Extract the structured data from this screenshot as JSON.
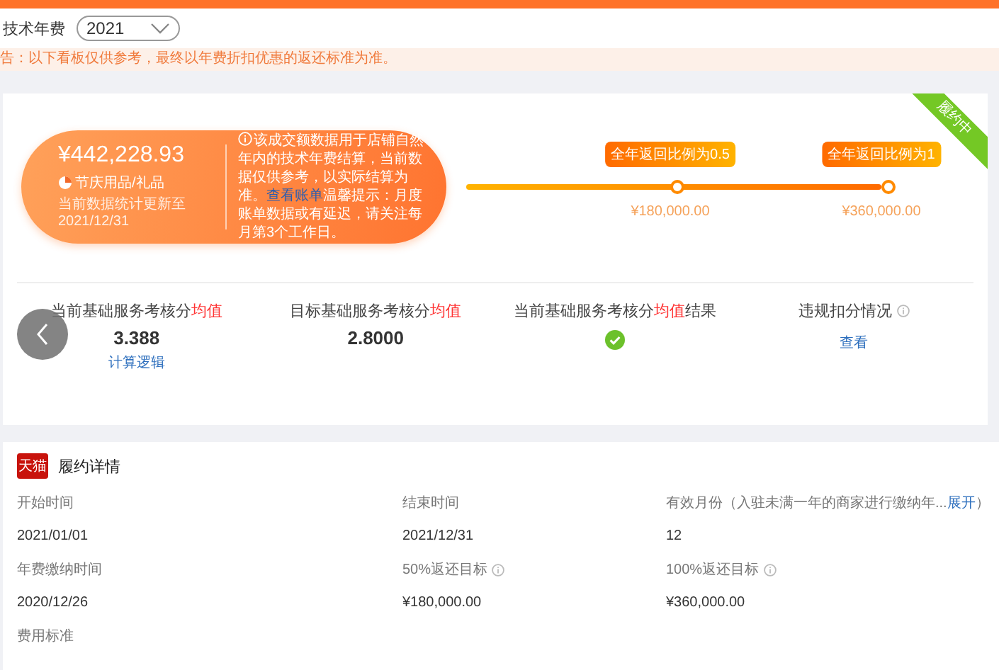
{
  "header": {
    "label": "技术年费",
    "year_select": {
      "value": "2021"
    }
  },
  "notice": "告：以下看板仅供参考，最终以年费折扣优惠的返还标准为准。",
  "summary": {
    "status_ribbon": "履约中",
    "amount": "¥442,228.93",
    "category": "节庆用品/礼品",
    "update_note": "当前数据统计更新至 2021/12/31",
    "info_before": "该成交额数据用于店铺自然年内的技术年费结算，当前数据仅供参考，以实际结算为准。",
    "info_link": "查看账单",
    "info_after": "温馨提示：月度账单数据或有延迟，请关注每月第3个工作日。",
    "milestones": [
      {
        "tip": "全年返回比例为0.5",
        "amount": "¥180,000.00"
      },
      {
        "tip": "全年返回比例为1",
        "amount": "¥360,000.00"
      }
    ]
  },
  "stats": [
    {
      "kind": "value",
      "title_before": "当前基础服务考核分",
      "title_highlight": "均值",
      "value": "3.388",
      "link": "计算逻辑"
    },
    {
      "kind": "value",
      "title_before": "目标基础服务考核分",
      "title_highlight": "均值",
      "value": "2.8000"
    },
    {
      "kind": "check",
      "title_before": "当前基础服务考核分",
      "title_highlight": "均值",
      "title_after": "结果"
    },
    {
      "kind": "link",
      "title_before": "违规扣分情况",
      "info": true,
      "link": "查看"
    }
  ],
  "details": {
    "logo": "天猫",
    "title": "履约详情",
    "fields": [
      {
        "label": "开始时间",
        "value": "2021/01/01"
      },
      {
        "label": "结束时间",
        "value": "2021/12/31"
      },
      {
        "label": "有效月份（入驻未满一年的商家进行缴纳年...",
        "link": "展开",
        "label_after": "）",
        "value": "12"
      },
      {
        "label": "年费缴纳时间",
        "value": "2020/12/26"
      },
      {
        "label": "50%返还目标",
        "info": true,
        "value": "¥180,000.00"
      },
      {
        "label": "100%返还目标",
        "info": true,
        "value": "¥360,000.00"
      },
      {
        "label": "费用标准"
      }
    ]
  }
}
